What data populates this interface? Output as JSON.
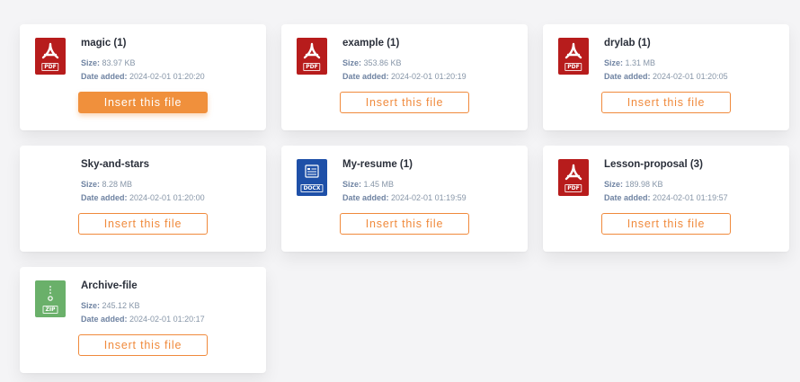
{
  "colors": {
    "accent": "#f08a3c",
    "pdf": "#b71c1c",
    "docx": "#1e50a8",
    "zip": "#6ab06a"
  },
  "labels": {
    "size": "Size:",
    "date_added": "Date added:"
  },
  "files": [
    {
      "name": "magic (1)",
      "size": "83.97 KB",
      "date": "2024-02-01 01:20:20",
      "type": "pdf",
      "badge": "PDF",
      "icon": "pdf-icon",
      "button": "Insert this file",
      "button_state": "hover"
    },
    {
      "name": "example (1)",
      "size": "353.86 KB",
      "date": "2024-02-01 01:20:19",
      "type": "pdf",
      "badge": "PDF",
      "icon": "pdf-icon",
      "button": "Insert this file"
    },
    {
      "name": "drylab (1)",
      "size": "1.31 MB",
      "date": "2024-02-01 01:20:05",
      "type": "pdf",
      "badge": "PDF",
      "icon": "pdf-icon",
      "button": "Insert this file"
    },
    {
      "name": "Sky-and-stars",
      "size": "8.28 MB",
      "date": "2024-02-01 01:20:00",
      "type": "none",
      "badge": "",
      "icon": "",
      "button": "Insert this file"
    },
    {
      "name": "My-resume (1)",
      "size": "1.45 MB",
      "date": "2024-02-01 01:19:59",
      "type": "docx",
      "badge": "DOCX",
      "icon": "docx-icon",
      "button": "Insert this file"
    },
    {
      "name": "Lesson-proposal (3)",
      "size": "189.98 KB",
      "date": "2024-02-01 01:19:57",
      "type": "pdf",
      "badge": "PDF",
      "icon": "pdf-icon",
      "button": "Insert this file"
    },
    {
      "name": "Archive-file",
      "size": "245.12 KB",
      "date": "2024-02-01 01:20:17",
      "type": "zip",
      "badge": "ZIP",
      "icon": "zip-icon",
      "button": "Insert this file"
    }
  ]
}
